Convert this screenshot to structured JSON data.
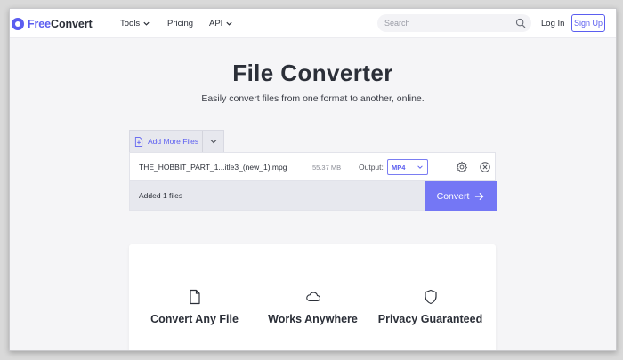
{
  "brand": {
    "part1": "Free",
    "part2": "Convert",
    "accent_color": "#5b5ef0"
  },
  "nav": {
    "tools": "Tools",
    "pricing": "Pricing",
    "api": "API",
    "search_placeholder": "Search",
    "login": "Log In",
    "signup": "Sign Up"
  },
  "hero": {
    "title": "File Converter",
    "subtitle": "Easily convert files from one format to another, online."
  },
  "converter": {
    "add_more_label": "Add More Files",
    "file": {
      "name": "THE_HOBBIT_PART_1...itle3_(new_1).mpg",
      "size": "55.37 MB",
      "output_label": "Output:",
      "output_value": "MP4"
    },
    "added_text": "Added 1 files",
    "convert_label": "Convert",
    "convert_color": "#7477f5"
  },
  "features": [
    {
      "label": "Convert Any File",
      "icon": "file-icon"
    },
    {
      "label": "Works Anywhere",
      "icon": "cloud-icon"
    },
    {
      "label": "Privacy Guaranteed",
      "icon": "shield-icon"
    }
  ]
}
